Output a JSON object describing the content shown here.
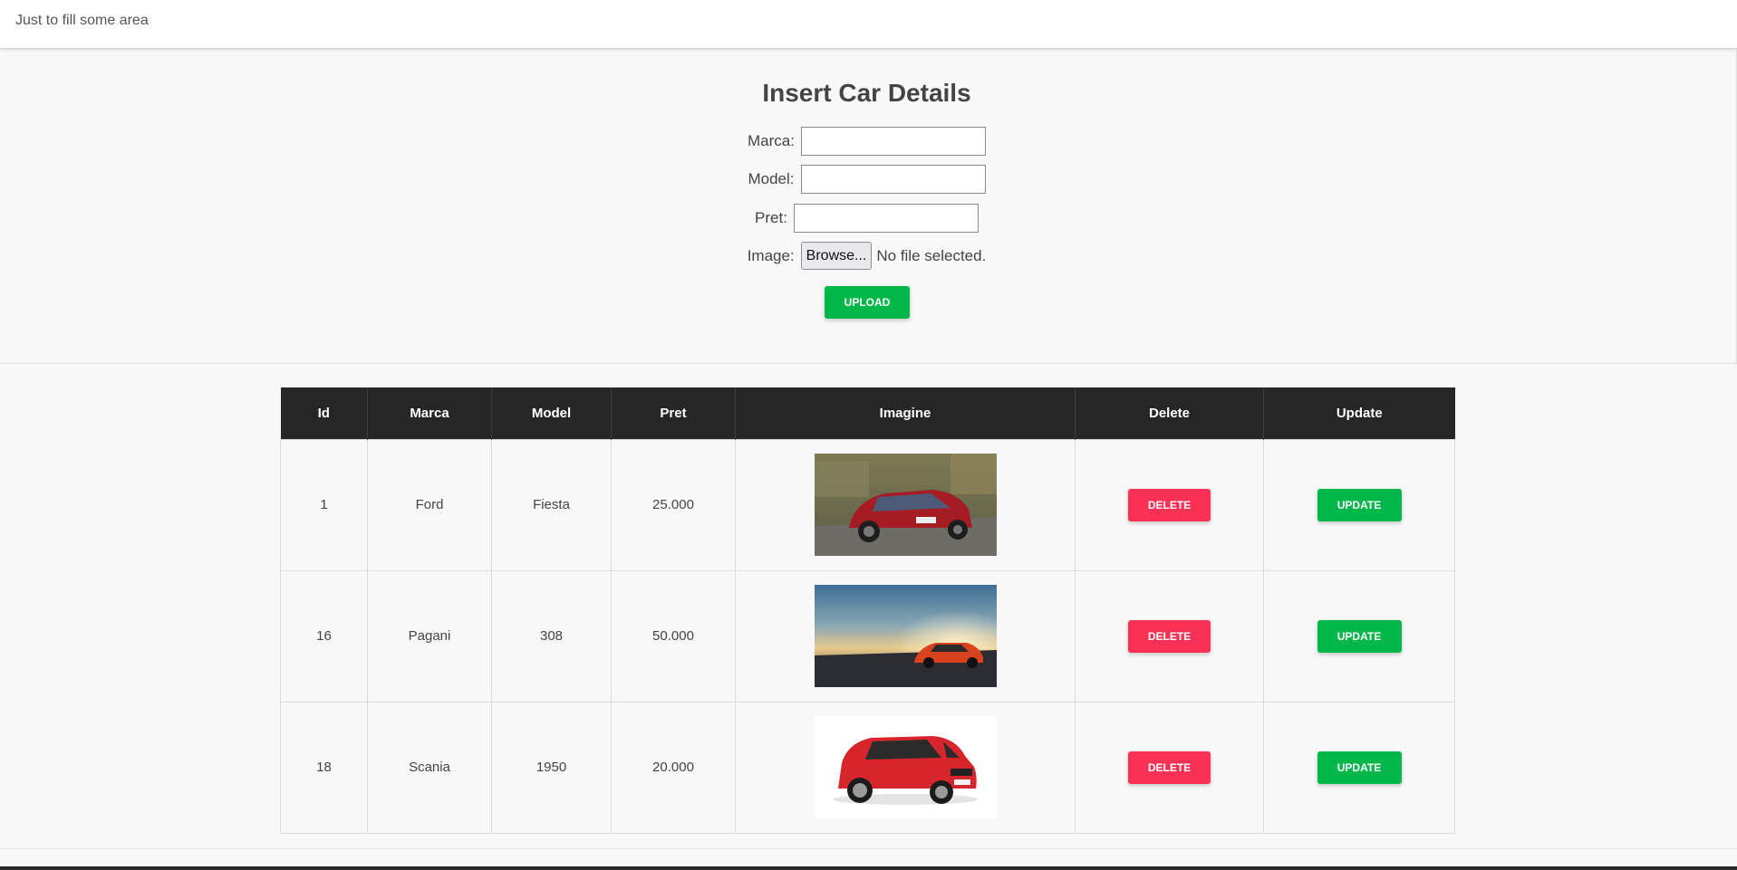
{
  "topbar": {
    "text": "Just to fill some area"
  },
  "form": {
    "title": "Insert Car Details",
    "marca_label": "Marca:",
    "marca_value": "",
    "model_label": "Model:",
    "model_value": "",
    "pret_label": "Pret:",
    "pret_value": "",
    "image_label": "Image:",
    "browse_label": "Browse...",
    "file_status": "No file selected.",
    "upload_label": "UPLOAD"
  },
  "table": {
    "headers": [
      "Id",
      "Marca",
      "Model",
      "Pret",
      "Imagine",
      "Delete",
      "Update"
    ],
    "rows": [
      {
        "id": "1",
        "marca": "Ford",
        "model": "Fiesta",
        "pret": "25.000",
        "image": "red-suv-on-road",
        "delete": "DELETE",
        "update": "UPDATE"
      },
      {
        "id": "16",
        "marca": "Pagani",
        "model": "308",
        "pret": "50.000",
        "image": "orange-sports-car-sunset",
        "delete": "DELETE",
        "update": "UPDATE"
      },
      {
        "id": "18",
        "marca": "Scania",
        "model": "1950",
        "pret": "20.000",
        "image": "red-compact-suv-white-bg",
        "delete": "DELETE",
        "update": "UPDATE"
      }
    ]
  },
  "colors": {
    "upload": "#00b74a",
    "delete": "#f93154",
    "update": "#00b74a",
    "table_header": "#262626"
  }
}
